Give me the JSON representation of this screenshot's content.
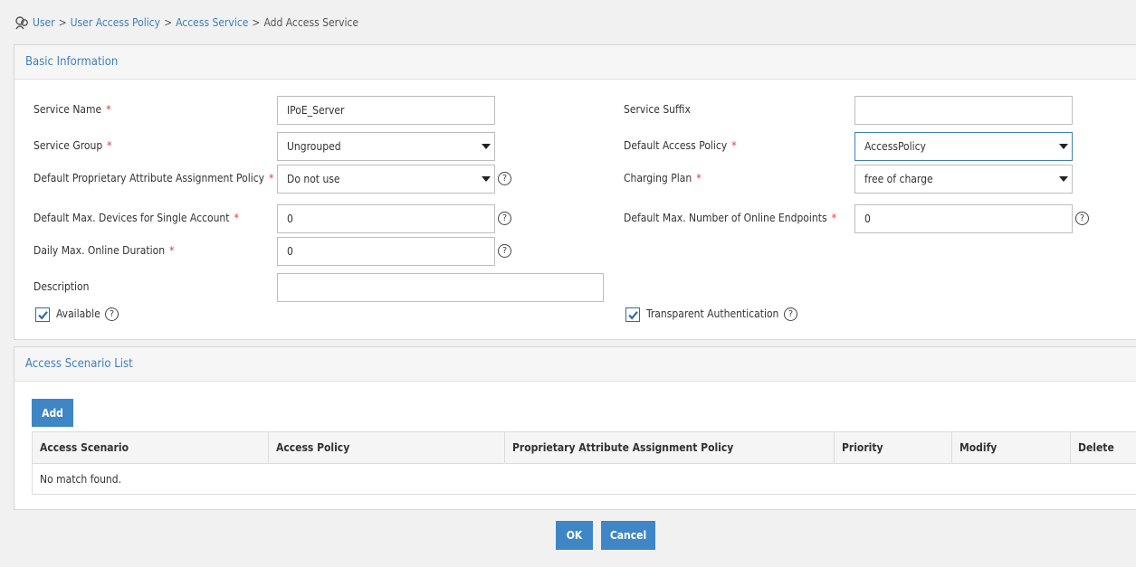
{
  "breadcrumb": {
    "items": [
      "User",
      "User Access Policy",
      "Access Service"
    ],
    "separator": ">",
    "current": "Add Access Service"
  },
  "basic_info": {
    "title": "Basic Information",
    "required_mark": "*",
    "help_glyph": "?",
    "service_name": {
      "label": "Service Name",
      "value": "IPoE_Server"
    },
    "service_suffix": {
      "label": "Service Suffix",
      "value": ""
    },
    "service_group": {
      "label": "Service Group",
      "value": "Ungrouped"
    },
    "default_access_policy": {
      "label": "Default Access Policy",
      "value": "AccessPolicy"
    },
    "default_proprietary_policy": {
      "label": "Default Proprietary Attribute Assignment Policy",
      "value": "Do not use"
    },
    "charging_plan": {
      "label": "Charging Plan",
      "value": "free of charge"
    },
    "max_devices": {
      "label": "Default Max. Devices for Single Account",
      "value": "0"
    },
    "max_online_endpoints": {
      "label": "Default Max. Number of Online Endpoints",
      "value": "0"
    },
    "daily_max_duration": {
      "label": "Daily Max. Online Duration",
      "value": "0"
    },
    "description": {
      "label": "Description",
      "value": ""
    },
    "available": {
      "label": "Available",
      "checked": true
    },
    "transparent_auth": {
      "label": "Transparent Authentication",
      "checked": true
    }
  },
  "scenario_list": {
    "title": "Access Scenario List",
    "add_label": "Add",
    "columns": [
      "Access Scenario",
      "Access Policy",
      "Proprietary Attribute Assignment Policy",
      "Priority",
      "Modify",
      "Delete"
    ],
    "empty_text": "No match found."
  },
  "actions": {
    "ok_label": "OK",
    "cancel_label": "Cancel"
  },
  "colors": {
    "accent": "#3e86c6",
    "link": "#3f7fbf",
    "required": "#e53935"
  }
}
